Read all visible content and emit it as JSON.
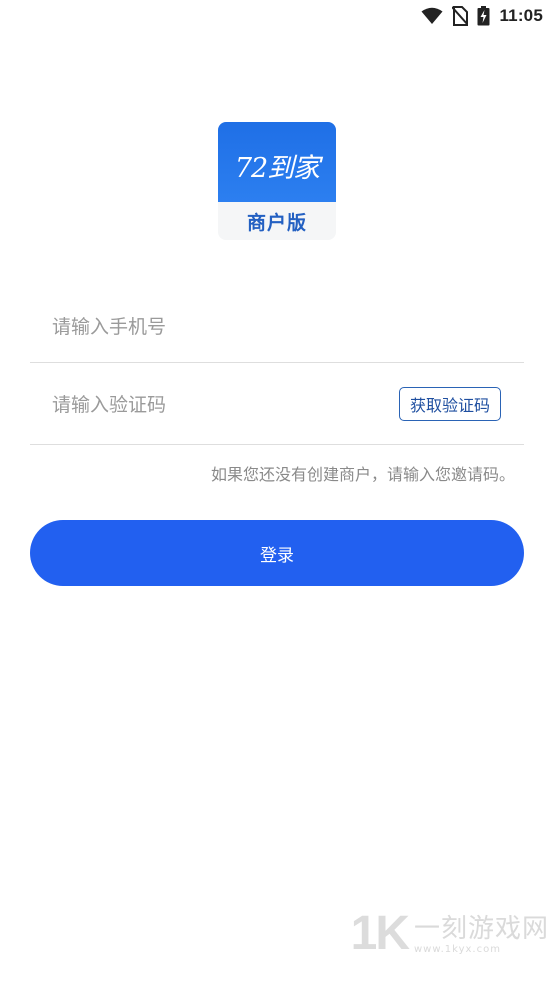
{
  "status_bar": {
    "time": "11:05",
    "icons": [
      "wifi-icon",
      "no-sim-icon",
      "battery-charging-icon"
    ]
  },
  "logo": {
    "title": "72到家",
    "subtitle": "商户版",
    "colors": {
      "top": "#1f6fe6",
      "bottom": "#f5f6f7",
      "subtitle": "#2360c2"
    }
  },
  "form": {
    "phone_placeholder": "请输入手机号",
    "phone_value": "",
    "code_placeholder": "请输入验证码",
    "code_value": "",
    "get_code_label": "获取验证码",
    "invite_hint": "如果您还没有创建商户，请输入您邀请码。",
    "login_label": "登录"
  },
  "watermark": {
    "mark": "1K",
    "name": "一刻游戏网",
    "url": "www.1kyx.com"
  },
  "colors": {
    "accent": "#2260f0",
    "border": "#dedede",
    "hint": "#8a8a8a",
    "placeholder": "#9a9a9a"
  }
}
